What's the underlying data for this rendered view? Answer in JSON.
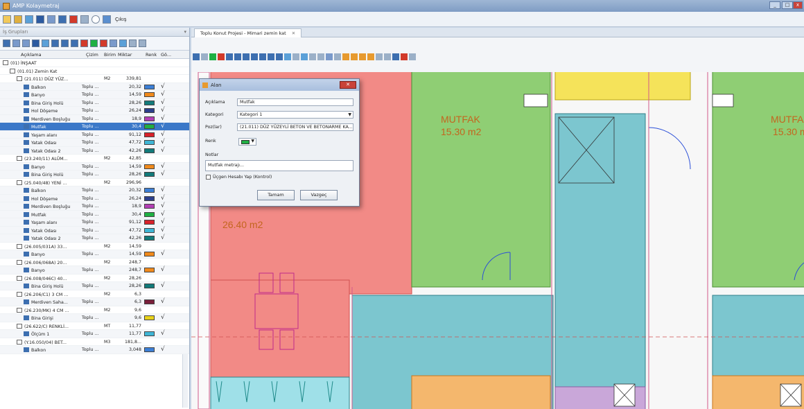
{
  "window": {
    "title": "AMP Kolaymetraj"
  },
  "quickbar": {
    "exit_label": "Çıkış"
  },
  "left_panel": {
    "header": "İş Grupları",
    "columns": {
      "aciklama": "Açıklama",
      "cizim": "Çizim",
      "birim": "Birim",
      "miktar": "Miktar",
      "renk": "Renk",
      "go": "Gö..."
    },
    "rows": [
      {
        "kind": "group",
        "level": 0,
        "name": "(01) İNŞAAT",
        "cizim": "",
        "birim": "",
        "miktar": "",
        "color": "",
        "check": ""
      },
      {
        "kind": "group",
        "level": 1,
        "name": "(01.01) Zemin Kat",
        "cizim": "",
        "birim": "",
        "miktar": "",
        "color": "",
        "check": ""
      },
      {
        "kind": "group",
        "level": 2,
        "name": "(21.011) DÜZ YÜZ...",
        "cizim": "",
        "birim": "M2",
        "miktar": "339,81",
        "color": "",
        "check": ""
      },
      {
        "kind": "item",
        "level": 3,
        "name": "Balkon",
        "cizim": "Toplu ...",
        "birim": "",
        "miktar": "20,32",
        "color": "#3c7fd6",
        "check": "√"
      },
      {
        "kind": "item",
        "level": 3,
        "name": "Banyo",
        "cizim": "Toplu ...",
        "birim": "",
        "miktar": "14,59",
        "color": "#f08a1c",
        "check": "√"
      },
      {
        "kind": "item",
        "level": 3,
        "name": "Bina Giriş Holü",
        "cizim": "Toplu ...",
        "birim": "",
        "miktar": "28,26",
        "color": "#127a7a",
        "check": "√"
      },
      {
        "kind": "item",
        "level": 3,
        "name": "Hol Döşeme",
        "cizim": "Toplu ...",
        "birim": "",
        "miktar": "26,24",
        "color": "#2c3f8c",
        "check": "√"
      },
      {
        "kind": "item",
        "level": 3,
        "name": "Merdiven Boşluğu",
        "cizim": "Toplu ...",
        "birim": "",
        "miktar": "18,9",
        "color": "#b23fb4",
        "check": "√"
      },
      {
        "kind": "item",
        "level": 3,
        "name": "Mutfak",
        "cizim": "Toplu ...",
        "birim": "",
        "miktar": "30,4",
        "color": "#1fb043",
        "check": "√",
        "selected": true
      },
      {
        "kind": "item",
        "level": 3,
        "name": "Yaşam alanı",
        "cizim": "Toplu ...",
        "birim": "",
        "miktar": "91,12",
        "color": "#d8222a",
        "check": "√"
      },
      {
        "kind": "item",
        "level": 3,
        "name": "Yatak Odası",
        "cizim": "Toplu ...",
        "birim": "",
        "miktar": "47,72",
        "color": "#3fb6d6",
        "check": "√"
      },
      {
        "kind": "item",
        "level": 3,
        "name": "Yatak Odası 2",
        "cizim": "Toplu ...",
        "birim": "",
        "miktar": "42,26",
        "color": "#127a7a",
        "check": "√"
      },
      {
        "kind": "group",
        "level": 2,
        "name": "(23.240/11) ALÜM...",
        "cizim": "",
        "birim": "M2",
        "miktar": "42,85",
        "color": "",
        "check": ""
      },
      {
        "kind": "item",
        "level": 3,
        "name": "Banyo",
        "cizim": "Toplu ...",
        "birim": "",
        "miktar": "14,59",
        "color": "#f08a1c",
        "check": "√"
      },
      {
        "kind": "item",
        "level": 3,
        "name": "Bina Giriş Holü",
        "cizim": "Toplu ...",
        "birim": "",
        "miktar": "28,26",
        "color": "#127a7a",
        "check": "√"
      },
      {
        "kind": "group",
        "level": 2,
        "name": "(25.040/48) YENİ ...",
        "cizim": "",
        "birim": "M2",
        "miktar": "296,96",
        "color": "",
        "check": ""
      },
      {
        "kind": "item",
        "level": 3,
        "name": "Balkon",
        "cizim": "Toplu ...",
        "birim": "",
        "miktar": "20,32",
        "color": "#3c7fd6",
        "check": "√"
      },
      {
        "kind": "item",
        "level": 3,
        "name": "Hol Döşeme",
        "cizim": "Toplu ...",
        "birim": "",
        "miktar": "26,24",
        "color": "#2c3f8c",
        "check": "√"
      },
      {
        "kind": "item",
        "level": 3,
        "name": "Merdiven Boşluğu",
        "cizim": "Toplu ...",
        "birim": "",
        "miktar": "18,9",
        "color": "#b23fb4",
        "check": "√"
      },
      {
        "kind": "item",
        "level": 3,
        "name": "Mutfak",
        "cizim": "Toplu ...",
        "birim": "",
        "miktar": "30,4",
        "color": "#1fb043",
        "check": "√"
      },
      {
        "kind": "item",
        "level": 3,
        "name": "Yaşam alanı",
        "cizim": "Toplu ...",
        "birim": "",
        "miktar": "91,12",
        "color": "#d8222a",
        "check": "√"
      },
      {
        "kind": "item",
        "level": 3,
        "name": "Yatak Odası",
        "cizim": "Toplu ...",
        "birim": "",
        "miktar": "47,72",
        "color": "#3fb6d6",
        "check": "√"
      },
      {
        "kind": "item",
        "level": 3,
        "name": "Yatak Odası 2",
        "cizim": "Toplu ...",
        "birim": "",
        "miktar": "42,26",
        "color": "#127a7a",
        "check": "√"
      },
      {
        "kind": "group",
        "level": 2,
        "name": "(26.005/031A) 33...",
        "cizim": "",
        "birim": "M2",
        "miktar": "14,59",
        "color": "",
        "check": ""
      },
      {
        "kind": "item",
        "level": 3,
        "name": "Banyo",
        "cizim": "Toplu ...",
        "birim": "",
        "miktar": "14,59",
        "color": "#f08a1c",
        "check": "√"
      },
      {
        "kind": "group",
        "level": 2,
        "name": "(26.006/068A) 20...",
        "cizim": "",
        "birim": "M2",
        "miktar": "248,7",
        "color": "",
        "check": ""
      },
      {
        "kind": "item",
        "level": 3,
        "name": "Banyo",
        "cizim": "Toplu ...",
        "birim": "",
        "miktar": "248,7",
        "color": "#f08a1c",
        "check": "√"
      },
      {
        "kind": "group",
        "level": 2,
        "name": "(26.008/046C) 40...",
        "cizim": "",
        "birim": "M2",
        "miktar": "28,26",
        "color": "",
        "check": ""
      },
      {
        "kind": "item",
        "level": 3,
        "name": "Bina Giriş Holü",
        "cizim": "Toplu ...",
        "birim": "",
        "miktar": "28,26",
        "color": "#127a7a",
        "check": "√"
      },
      {
        "kind": "group",
        "level": 2,
        "name": "(26.206/C1) 3 CM ...",
        "cizim": "",
        "birim": "M2",
        "miktar": "6,3",
        "color": "",
        "check": ""
      },
      {
        "kind": "item",
        "level": 3,
        "name": "Merdiven Saha...",
        "cizim": "Toplu ...",
        "birim": "",
        "miktar": "6,3",
        "color": "#7a1f3a",
        "check": "√"
      },
      {
        "kind": "group",
        "level": 2,
        "name": "(26.230/MK) 4 CM ...",
        "cizim": "",
        "birim": "M2",
        "miktar": "9,6",
        "color": "",
        "check": ""
      },
      {
        "kind": "item",
        "level": 3,
        "name": "Bina Girişi",
        "cizim": "Toplu ...",
        "birim": "",
        "miktar": "9,6",
        "color": "#e8d21a",
        "check": "√"
      },
      {
        "kind": "group",
        "level": 2,
        "name": "(26.622/C) RENKLİ...",
        "cizim": "",
        "birim": "MT",
        "miktar": "11,77",
        "color": "",
        "check": ""
      },
      {
        "kind": "item",
        "level": 3,
        "name": "Ölçüm 1",
        "cizim": "Toplu ...",
        "birim": "",
        "miktar": "11,77",
        "color": "#3fb6d6",
        "check": "√"
      },
      {
        "kind": "group",
        "level": 2,
        "name": "(Y.16.050/04) BET...",
        "cizim": "",
        "birim": "M3",
        "miktar": "181,8...",
        "color": "",
        "check": ""
      },
      {
        "kind": "item",
        "level": 3,
        "name": "Balkon",
        "cizim": "Toplu ...",
        "birim": "",
        "miktar": "3,048",
        "color": "#3c7fd6",
        "check": "√"
      }
    ]
  },
  "document": {
    "tab_label": "Toplu Konut Projesi - Mimari zemin kat",
    "rooms": [
      {
        "name": "MUTFAK",
        "area": "15.30 m2"
      },
      {
        "name": "MUTFA",
        "area": "15.30 m"
      },
      {
        "name": "",
        "area": "26.40 m2"
      }
    ]
  },
  "dialog": {
    "title": "Alan",
    "labels": {
      "aciklama": "Açıklama",
      "kategori": "Kategori",
      "poz": "Poz(lar)",
      "renk": "Renk",
      "notlar": "Notlar",
      "check": "Üçgen Hesabı Yap (Kontrol)"
    },
    "values": {
      "aciklama": "Mutfak",
      "kategori": "Kategori 1",
      "poz": "(21.011) DÜZ YÜZEYLİ BETON VE BETONARME KA...",
      "notlar": "Mutfak metrajı..."
    },
    "buttons": {
      "ok": "Tamam",
      "cancel": "Vazgeç"
    },
    "selected_color": "#1fb043"
  },
  "colors": {
    "kitchen": "#8fce74",
    "living": "#f26d6d",
    "bedroom": "#7cc6cf",
    "bath": "#f4b76d",
    "yellow": "#f5e35a"
  }
}
